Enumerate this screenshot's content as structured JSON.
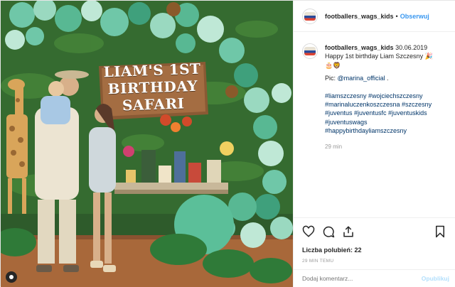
{
  "post": {
    "username": "footballers_wags_kids",
    "follow_label": "Obserwuj",
    "separator": "•",
    "photo_alt": "",
    "sign_lines": [
      "LIAM'S 1ST",
      "BIRTHDAY",
      "SAFARI"
    ]
  },
  "caption": {
    "username": "footballers_wags_kids",
    "date": "30.06.2019",
    "line1": "Happy 1st birthday Liam Szczesny 🎉",
    "line2": "🎂🦁",
    "pic_label": "Pic: ",
    "pic_mention": "@marina_official",
    "pic_suffix": " .",
    "hashtags": [
      "#liamszczesny #wojciechszczesny",
      "#marinaluczenkoszczesna #szczesny",
      "#juventus #juventusfc #juventuskids",
      "#juventuswags",
      "#happybirthdayliamszczesny"
    ],
    "time": "29 min"
  },
  "actions": {
    "likes": "Liczba polubień: 22",
    "ago": "29 MIN TEMU"
  },
  "comment": {
    "placeholder": "Dodaj komentarz...",
    "submit": "Opublikuj"
  },
  "colors": {
    "link": "#3897f0",
    "hashtag": "#003569",
    "muted": "#999999",
    "text": "#262626"
  },
  "icons": [
    "heart-icon",
    "comment-icon",
    "share-icon",
    "bookmark-icon",
    "profile-icon"
  ]
}
